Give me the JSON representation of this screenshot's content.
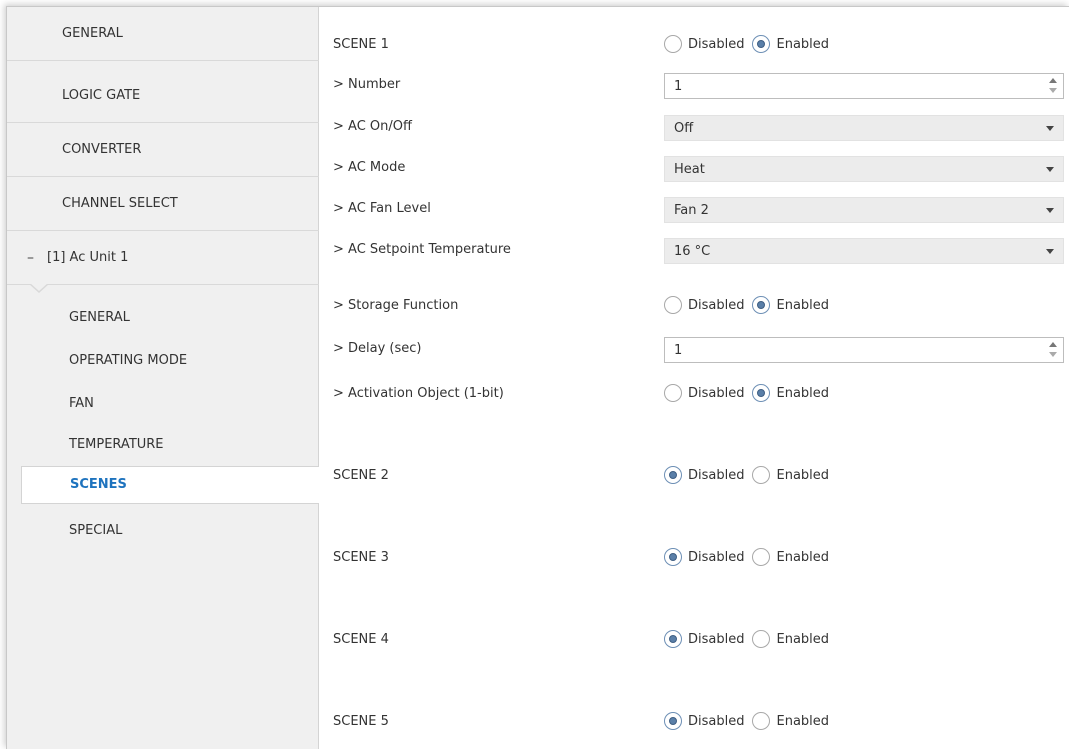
{
  "sidebar": {
    "top_items": [
      {
        "label": "GENERAL"
      },
      {
        "label": "LOGIC GATE"
      },
      {
        "label": "CONVERTER"
      },
      {
        "label": "CHANNEL SELECT"
      }
    ],
    "group": {
      "toggle": "–",
      "label": "[1] Ac Unit 1"
    },
    "sub_items": [
      {
        "label": "GENERAL"
      },
      {
        "label": "OPERATING MODE"
      },
      {
        "label": "FAN"
      },
      {
        "label": "TEMPERATURE"
      },
      {
        "label": "SCENES",
        "active": true
      },
      {
        "label": "SPECIAL"
      }
    ]
  },
  "options": {
    "disabled": "Disabled",
    "enabled": "Enabled"
  },
  "content": {
    "scene1": {
      "label": "SCENE 1",
      "value": "Enabled"
    },
    "number": {
      "label": "> Number",
      "value": "1"
    },
    "ac_onoff": {
      "label": "> AC On/Off",
      "value": "Off"
    },
    "ac_mode": {
      "label": "> AC Mode",
      "value": "Heat"
    },
    "ac_fan": {
      "label": "> AC Fan Level",
      "value": "Fan 2"
    },
    "ac_setpoint": {
      "label": "> AC Setpoint Temperature",
      "value": "16 °C"
    },
    "storage": {
      "label": "> Storage Function",
      "value": "Enabled"
    },
    "delay": {
      "label": "> Delay (sec)",
      "value": "1"
    },
    "activation": {
      "label": "> Activation Object (1-bit)",
      "value": "Enabled"
    },
    "scene2": {
      "label": "SCENE 2",
      "value": "Disabled"
    },
    "scene3": {
      "label": "SCENE 3",
      "value": "Disabled"
    },
    "scene4": {
      "label": "SCENE 4",
      "value": "Disabled"
    },
    "scene5": {
      "label": "SCENE 5",
      "value": "Disabled"
    }
  },
  "colors": {
    "accent": "#1e73be",
    "sidebar_bg": "#f0f0f0",
    "radio_fill": "#5a7fa8"
  }
}
